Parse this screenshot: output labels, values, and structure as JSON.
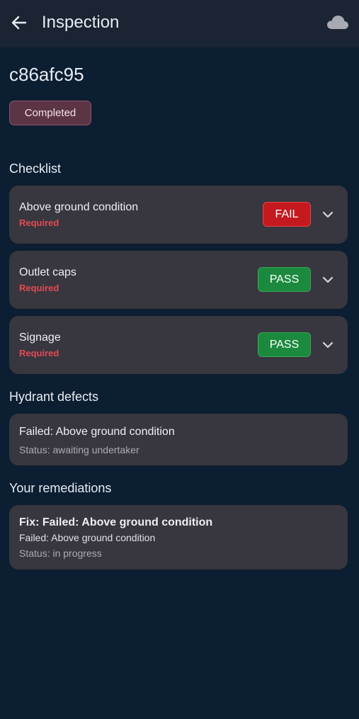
{
  "appbar": {
    "title": "Inspection",
    "back_icon": "arrow-left-icon",
    "sync_icon": "cloud-icon"
  },
  "record": {
    "id": "c86afc95",
    "status": "Completed"
  },
  "checklist": {
    "title": "Checklist",
    "items": [
      {
        "label": "Above ground condition",
        "required": "Required",
        "result": "FAIL"
      },
      {
        "label": "Outlet caps",
        "required": "Required",
        "result": "PASS"
      },
      {
        "label": "Signage",
        "required": "Required",
        "result": "PASS"
      }
    ]
  },
  "defects": {
    "title": "Hydrant defects",
    "items": [
      {
        "title": "Failed: Above ground condition",
        "status": "Status: awaiting undertaker"
      }
    ]
  },
  "remediations": {
    "title": "Your remediations",
    "items": [
      {
        "title": "Fix: Failed: Above ground condition",
        "defect": "Failed: Above ground condition",
        "status": "Status: in progress"
      }
    ]
  },
  "colors": {
    "background": "#0c1e31",
    "appbar": "#1a2433",
    "card": "#38363e",
    "fail": "#c4191f",
    "pass": "#1b8a3e",
    "required": "#e24b55",
    "status_chip": "#5c3545"
  }
}
